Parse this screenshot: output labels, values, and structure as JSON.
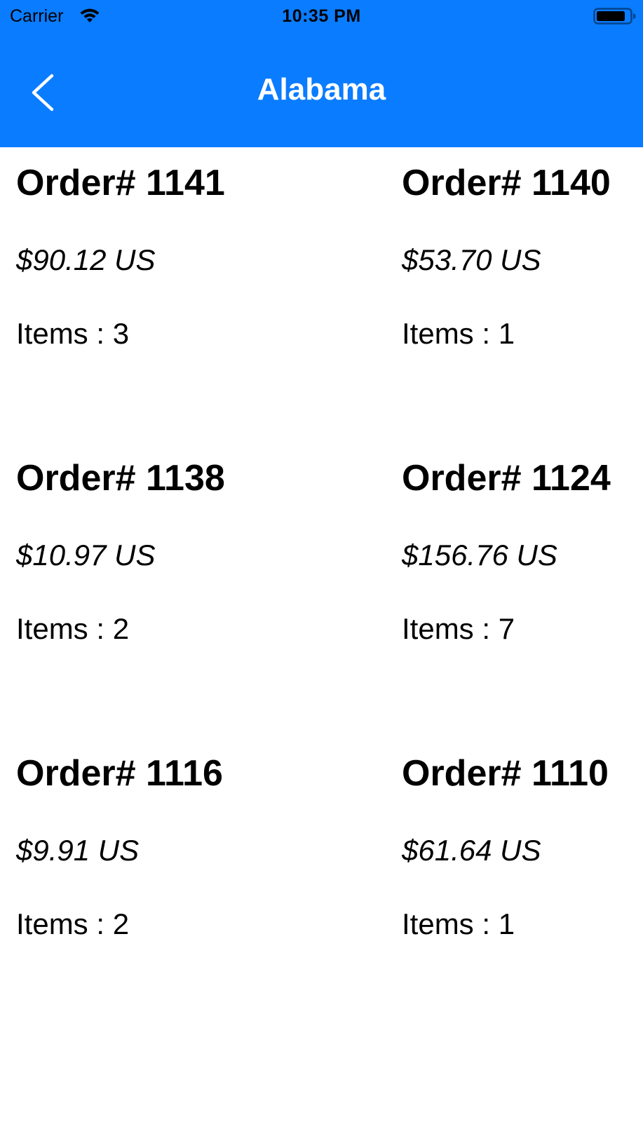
{
  "status_bar": {
    "carrier": "Carrier",
    "time": "10:35 PM",
    "wifi_icon": "wifi-icon",
    "battery_icon": "battery-icon",
    "battery_level": 0.85
  },
  "nav": {
    "title": "Alabama",
    "back_icon": "chevron-left-icon",
    "background_color": "#0a7cff",
    "title_color": "#ffffff"
  },
  "orders": [
    {
      "title": "Order# 1141",
      "price": "$90.12 US",
      "items": "Items : 3"
    },
    {
      "title": "Order# 1140",
      "price": "$53.70 US",
      "items": "Items : 1"
    },
    {
      "title": "Order# 1138",
      "price": "$10.97 US",
      "items": "Items : 2"
    },
    {
      "title": "Order# 1124",
      "price": "$156.76 US",
      "items": "Items : 7"
    },
    {
      "title": "Order# 1116",
      "price": "$9.91 US",
      "items": "Items : 2"
    },
    {
      "title": "Order# 1110",
      "price": "$61.64 US",
      "items": "Items : 1"
    }
  ]
}
